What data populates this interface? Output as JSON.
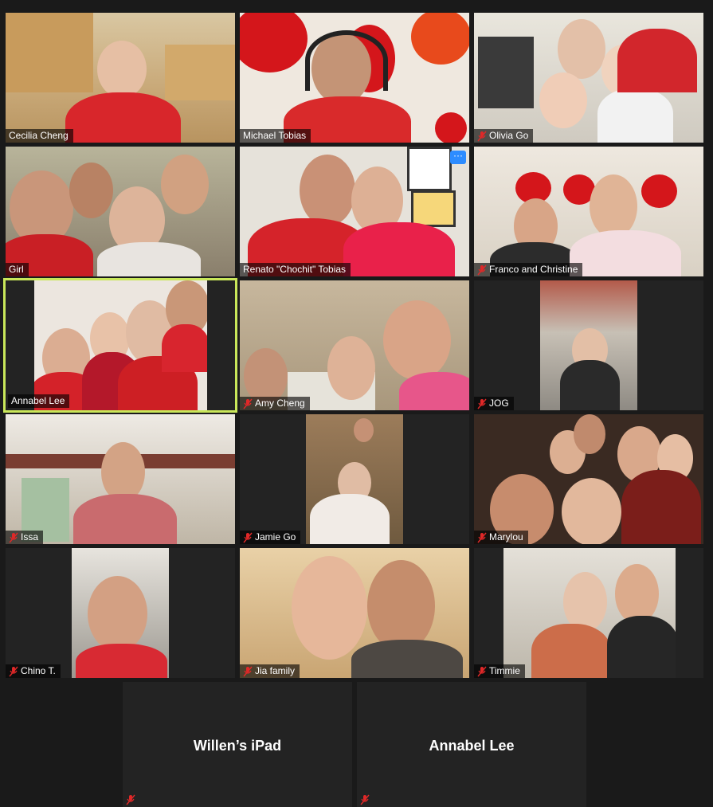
{
  "participants": [
    {
      "name": "Cecilia Cheng",
      "muted": false
    },
    {
      "name": "Michael Tobias",
      "muted": false
    },
    {
      "name": "Olivia Go",
      "muted": true
    },
    {
      "name": "Girl",
      "muted": false
    },
    {
      "name": "Renato \"Chochit\" Tobias",
      "muted": false
    },
    {
      "name": "Franco and Christine",
      "muted": true
    },
    {
      "name": "Annabel Lee",
      "muted": false
    },
    {
      "name": "Amy Cheng",
      "muted": true
    },
    {
      "name": "JOG",
      "muted": true
    },
    {
      "name": "Issa",
      "muted": true
    },
    {
      "name": "Jamie Go",
      "muted": true
    },
    {
      "name": "Marylou",
      "muted": true
    },
    {
      "name": "Chino T.",
      "muted": true
    },
    {
      "name": "Jia family",
      "muted": true
    },
    {
      "name": "Timmie",
      "muted": true
    }
  ],
  "video_off": [
    {
      "name": "Willen’s iPad"
    },
    {
      "name": "Annabel Lee"
    }
  ],
  "more_options_label": "···",
  "colors": {
    "active_speaker_border": "#c9e75a",
    "muted_mic": "#e02828",
    "accent": "#2d8cff"
  }
}
